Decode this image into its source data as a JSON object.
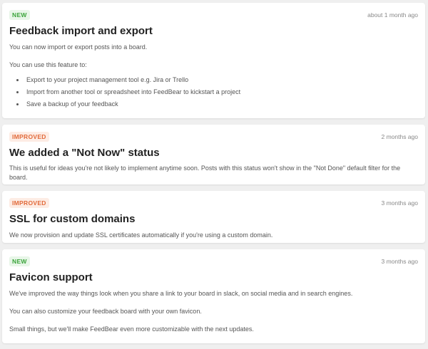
{
  "posts": [
    {
      "badge": "NEW",
      "time": "about 1 month ago",
      "title": "Feedback import and export",
      "paragraphs": [
        "You can now import or export posts into a board.",
        "You can use this feature to:"
      ],
      "bullets": [
        "Export to your project management tool e.g. Jira or Trello",
        "Import from another tool or spreadsheet into FeedBear to kickstart a project",
        "Save a backup of your feedback"
      ]
    },
    {
      "badge": "IMPROVED",
      "time": "2 months ago",
      "title": "We added a \"Not Now\" status",
      "paragraphs": [
        "This is useful for ideas you're not likely to implement anytime soon. Posts with this status won't show in the \"Not Done\" default filter for the board."
      ]
    },
    {
      "badge": "IMPROVED",
      "time": "3 months ago",
      "title": "SSL for custom domains",
      "paragraphs": [
        "We now provision and update SSL certificates automatically if you're using a custom domain."
      ]
    },
    {
      "badge": "NEW",
      "time": "3 months ago",
      "title": "Favicon support",
      "paragraphs": [
        "We've improved the way things look when you share a link to your board in slack, on social media and in search engines.",
        "You can also customize your feedback board with your own favicon.",
        "Small things, but we'll make FeedBear even more customizable with the next updates."
      ]
    }
  ],
  "colors": {
    "new_badge": "#3aa43a",
    "improved_badge": "#e26a3a"
  }
}
